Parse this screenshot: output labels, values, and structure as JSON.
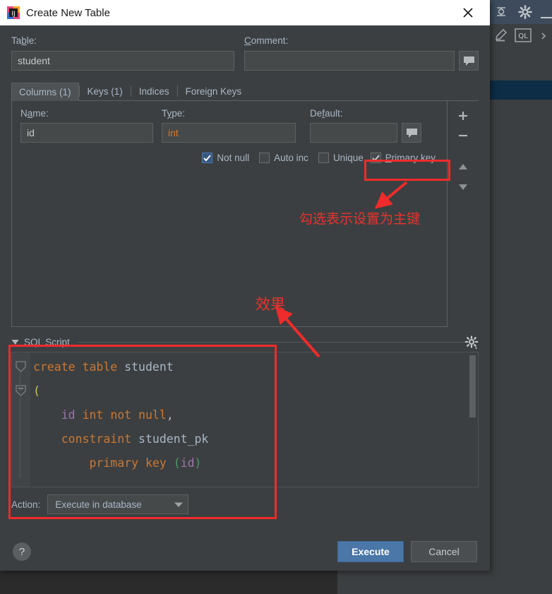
{
  "window": {
    "title": "Create New Table",
    "app_icon": "intellij-idea-icon",
    "close_icon": "close-icon"
  },
  "form": {
    "table_label": "Table:",
    "table_value": "student",
    "table_placeholder": "",
    "comment_label": "Comment:",
    "comment_value": "",
    "comment_placeholder": "",
    "comment_button_icon": "speech-bubble-icon"
  },
  "tabs": [
    {
      "label": "Columns (1)",
      "active": true
    },
    {
      "label": "Keys (1)",
      "active": false
    },
    {
      "label": "Indices",
      "active": false
    },
    {
      "label": "Foreign Keys",
      "active": false
    }
  ],
  "column_editor": {
    "name_label": "Name:",
    "type_label": "Type:",
    "default_label": "Default:",
    "name_value": "id",
    "type_value": "int",
    "default_value": "",
    "default_button_icon": "speech-bubble-icon",
    "checkboxes": [
      {
        "label": "Not null",
        "checked": true,
        "style": "blue"
      },
      {
        "label": "Auto inc",
        "checked": false,
        "style": "plain"
      },
      {
        "label": "Unique",
        "checked": false,
        "style": "plain"
      },
      {
        "label": "Primary key",
        "checked": true,
        "style": "gray"
      }
    ],
    "side_buttons": [
      {
        "icon": "plus-icon",
        "label": "+"
      },
      {
        "icon": "minus-icon",
        "label": "−"
      },
      {
        "icon": "move-up-icon",
        "label": "▲"
      },
      {
        "icon": "move-down-icon",
        "label": "▼"
      }
    ]
  },
  "sql_section": {
    "header": "SQL Script",
    "settings_icon": "gear-icon",
    "collapse_icon": "triangle-down-icon",
    "code_lines": [
      [
        {
          "t": "create",
          "c": "kw"
        },
        {
          "t": " ",
          "c": "ident"
        },
        {
          "t": "table",
          "c": "kw"
        },
        {
          "t": " ",
          "c": "ident"
        },
        {
          "t": "student",
          "c": "ident"
        }
      ],
      [
        {
          "t": "(",
          "c": "paren-y"
        }
      ],
      [
        {
          "t": "    ",
          "c": "ident"
        },
        {
          "t": "id",
          "c": "var"
        },
        {
          "t": " ",
          "c": "ident"
        },
        {
          "t": "int",
          "c": "kw"
        },
        {
          "t": " ",
          "c": "ident"
        },
        {
          "t": "not",
          "c": "kw"
        },
        {
          "t": " ",
          "c": "ident"
        },
        {
          "t": "null",
          "c": "kw"
        },
        {
          "t": ",",
          "c": "ident"
        }
      ],
      [
        {
          "t": "    ",
          "c": "ident"
        },
        {
          "t": "constraint",
          "c": "kw"
        },
        {
          "t": " ",
          "c": "ident"
        },
        {
          "t": "student_pk",
          "c": "ident"
        }
      ],
      [
        {
          "t": "        ",
          "c": "ident"
        },
        {
          "t": "primary",
          "c": "kw"
        },
        {
          "t": " ",
          "c": "ident"
        },
        {
          "t": "key",
          "c": "kw"
        },
        {
          "t": " ",
          "c": "ident"
        },
        {
          "t": "(",
          "c": "paren-g"
        },
        {
          "t": "id",
          "c": "var"
        },
        {
          "t": ")",
          "c": "paren-g"
        }
      ]
    ]
  },
  "action": {
    "label": "Action:",
    "value": "Execute in database",
    "dropdown_icon": "chevron-down-icon"
  },
  "footer": {
    "help_label": "?",
    "execute_label": "Execute",
    "cancel_label": "Cancel"
  },
  "annotations": [
    {
      "type": "text",
      "text": "勾选表示设置为主键"
    },
    {
      "type": "text",
      "text": "效果"
    }
  ],
  "colors": {
    "annotation_red": "#e8332e",
    "primary_button": "#4a76a8",
    "keyword_orange": "#cc7832",
    "identifier": "#a9b7c6",
    "variable_purple": "#9876aa",
    "checkbox_blue": "#365880",
    "dialog_bg": "#3c3f41"
  },
  "background_ide": {
    "icons": [
      {
        "name": "collapse-all-icon"
      },
      {
        "name": "gear-icon"
      },
      {
        "name": "minimize-icon"
      },
      {
        "name": "edit-pencil-icon"
      },
      {
        "name": "ql-console-icon"
      }
    ]
  }
}
